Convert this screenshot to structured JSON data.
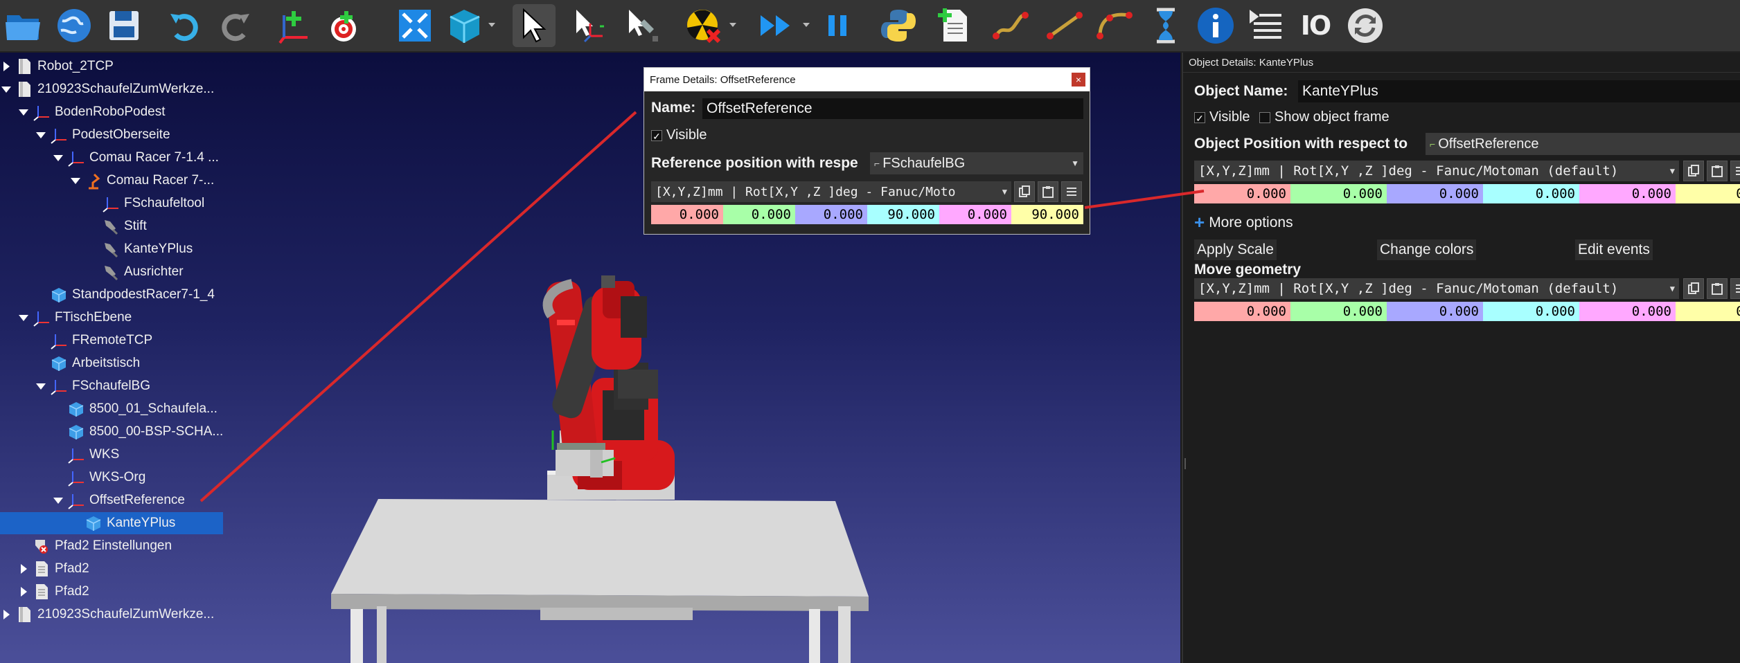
{
  "toolbar": {
    "io_label": "IO"
  },
  "tree": {
    "items": [
      {
        "label": "Robot_2TCP",
        "icon": "robot-file-icon"
      },
      {
        "label": "210923SchaufelZumWerkze...",
        "icon": "station-icon"
      },
      {
        "label": "BodenRoboPodest",
        "icon": "frame-icon"
      },
      {
        "label": "PodestOberseite",
        "icon": "frame-icon"
      },
      {
        "label": "Comau Racer 7-1.4 ...",
        "icon": "frame-icon"
      },
      {
        "label": "Comau Racer 7-...",
        "icon": "robot-icon"
      },
      {
        "label": "FSchaufeltool",
        "icon": "frame-icon"
      },
      {
        "label": "Stift",
        "icon": "tool-icon"
      },
      {
        "label": "KanteYPlus",
        "icon": "tool-icon"
      },
      {
        "label": "Ausrichter",
        "icon": "tool-icon"
      },
      {
        "label": "StandpodestRacer7-1_4",
        "icon": "object-icon"
      },
      {
        "label": "FTischEbene",
        "icon": "frame-icon"
      },
      {
        "label": "FRemoteTCP",
        "icon": "frame-icon"
      },
      {
        "label": "Arbeitstisch",
        "icon": "object-icon"
      },
      {
        "label": "FSchaufelBG",
        "icon": "frame-icon"
      },
      {
        "label": "8500_01_Schaufela...",
        "icon": "object-icon"
      },
      {
        "label": "8500_00-BSP-SCHA...",
        "icon": "object-icon"
      },
      {
        "label": "WKS",
        "icon": "frame-icon"
      },
      {
        "label": "WKS-Org",
        "icon": "frame-icon"
      },
      {
        "label": "OffsetReference",
        "icon": "frame-icon"
      },
      {
        "label": "KanteYPlus",
        "icon": "object-icon"
      },
      {
        "label": "Pfad2 Einstellungen",
        "icon": "settings-icon"
      },
      {
        "label": "Pfad2",
        "icon": "program-icon"
      },
      {
        "label": "Pfad2",
        "icon": "program-icon"
      },
      {
        "label": "210923SchaufelZumWerkze...",
        "icon": "station-icon"
      }
    ]
  },
  "frame_dialog": {
    "title": "Frame Details: OffsetReference",
    "close": "×",
    "name_label": "Name:",
    "name_value": "OffsetReference",
    "visible_label": "Visible",
    "visible_check": "✓",
    "ref_label": "Reference position with respe",
    "ref_value": "FSchaufelBG",
    "format_value": "[X,Y,Z]mm | Rot[X,Y ,Z  ]deg - Fanuc/Moto",
    "values": [
      "0.000",
      "0.000",
      "0.000",
      "90.000",
      "0.000",
      "90.000"
    ]
  },
  "right_panel": {
    "title": "Object Details: KanteYPlus",
    "name_label": "Object Name:",
    "name_value": "KanteYPlus",
    "visible_check": "✓",
    "visible_label": "Visible",
    "show_frame_label": "Show object frame",
    "position_label": "Object Position with respect to",
    "position_ref": "OffsetReference",
    "format_value": "[X,Y,Z]mm | Rot[X,Y ,Z  ]deg - Fanuc/Motoman (default)",
    "values": [
      "0.000",
      "0.000",
      "0.000",
      "0.000",
      "0.000",
      "0.00"
    ],
    "more_options": "More options",
    "apply_scale": "Apply Scale",
    "change_colors": "Change colors",
    "edit_events": "Edit events",
    "move_geometry": "Move geometry",
    "move_format": "[X,Y,Z]mm | Rot[X,Y ,Z  ]deg - Fanuc/Motoman (default)",
    "move_values": [
      "0.000",
      "0.000",
      "0.000",
      "0.000",
      "0.000",
      "0.00"
    ]
  },
  "colors": {
    "x": "#ffa8a8",
    "y": "#a8ffa8",
    "z": "#a8a8ff",
    "rx": "#a8ffff",
    "ry": "#ffa8ff",
    "rz": "#ffffa8"
  }
}
